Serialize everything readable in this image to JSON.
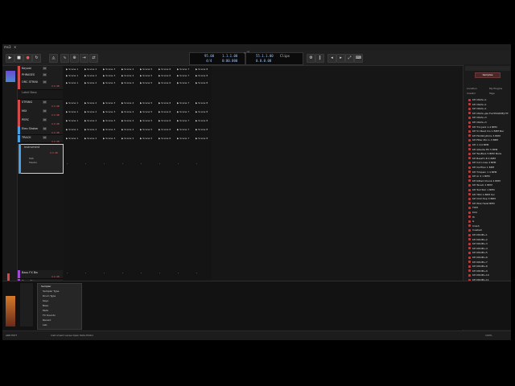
{
  "window": {
    "title": "ms3",
    "close_glyph": "✕"
  },
  "transport": {
    "tempo": "95.00",
    "signature": "4/4",
    "position_bars": "1.1.1.00",
    "position_time": "0:00.000",
    "loop_start": "55.1.1.00",
    "loop_end": "0.0.0.00",
    "mode": "Clips",
    "app_logo": "≈|||≈"
  },
  "tracks": [
    {
      "name": "Keyswi",
      "vol": "",
      "color": "#d44a4a"
    },
    {
      "name": "PHRASES",
      "vol": "",
      "color": "#d44a4a"
    },
    {
      "name": "ORC STRING",
      "vol": "0.0 dB",
      "color": "#d44a4a"
    },
    {
      "name": "Label Bass",
      "vol": "",
      "color": "#d44a4a"
    },
    {
      "name": "STRING",
      "vol": "0.0 dB",
      "color": "#d44a4a"
    },
    {
      "name": "MIX",
      "vol": "0.0 dB",
      "color": "#d44a4a"
    },
    {
      "name": "PERC",
      "vol": "0.0 dB",
      "color": "#d44a4a"
    },
    {
      "name": "Eleo Shaker",
      "vol": "0.0 dB",
      "color": "#4aa0e0"
    },
    {
      "name": "TRACK",
      "vol": "0.0 dB",
      "color": "#4aa0e0"
    }
  ],
  "selected_track": {
    "name": "Instrument",
    "vol": "0.0 dB",
    "sub1": "Midi",
    "sub2": "Master"
  },
  "bottom_tracks": [
    {
      "name": "Bass FX Beat",
      "vol": "0.0 dB",
      "color": "#a04ad4"
    },
    {
      "name": "Piano Triggered",
      "vol": "0.0 dB",
      "color": "#a04ad4"
    },
    {
      "name": "Master",
      "vol": "0.0 dB",
      "color": "#a04ad4"
    }
  ],
  "scenes": [
    "Scene 1",
    "Scene 2",
    "Scene 3",
    "Scene 4",
    "Scene 5",
    "Scene 6",
    "Scene 7",
    "Scene 8"
  ],
  "browser": {
    "tab_label": "Samples",
    "filter_a": "Location",
    "filter_b": "Creator",
    "filter_c": "My Plugins",
    "filter_d": "Tags",
    "items": [
      "KH CRAS+1",
      "KH CRAS+1",
      "KH CRAS+1",
      "KH CRAS+Jas FLATSSOMEJ HTI",
      "KH CRAS+3",
      "KH CRAS+3",
      "KH Trio Jazz 1-4 BPM",
      "KH 51 Beat Crs 1 BPM Bar",
      "KH FilmRhythms 3 BPM",
      "KH Filter Mix 1-3 BPM",
      "KH 1 1/4 BPM",
      "KH Alberta Fill 5 BPM",
      "KH TwoBars 5 BPM Mute",
      "KH BassFx B 4 BPM",
      "KH Cut Lines 4 BPM",
      "KH OutTrax 1 BPM",
      "KH Timpani 1 4 BPM",
      "KH Ar 4 1 BPM",
      "KH Kitted Chunk 4 BPM",
      "KH Tacelo 1 BPM",
      "KH TomTom 1 BPM",
      "KH TDD 1 BPM Sol",
      "KH Chill Hop 3 BPM",
      "KH Wile Heist BPM",
      "TOM",
      "Kick",
      "Hi",
      "G",
      "Crash",
      "Cowbell",
      "KH DRUM+1",
      "KH DRUM+2",
      "KH DRUM+3",
      "KH DRUM+4",
      "KH DRUM+5",
      "KH DRUM+6",
      "KH DRUM+7",
      "KH DRUM+8",
      "KH DRUM+9",
      "KH DRUM+10",
      "KH DRUM+11",
      "KH DRUM+12",
      "KH DRUM+13",
      "KH DRUM+14",
      "KH DRUM+15",
      "KH DRUM+16",
      "KH Wav Bass BPM"
    ]
  },
  "device_popup": {
    "title": "Sampler",
    "items": [
      "Sampler Type",
      "Drum Type",
      "Keys",
      "Bass",
      "Pads",
      "FX Sounds",
      "Recent",
      "Lab"
    ]
  },
  "status": {
    "left": "ARR   EDIT",
    "hint": "Instrument   Lanes   Open   Note Editor",
    "zoom": "100%"
  },
  "colors": {
    "accent": "#d44a4a",
    "blue": "#4aa0e0",
    "purple": "#a04ad4",
    "lcd": "#9cc8ff"
  }
}
